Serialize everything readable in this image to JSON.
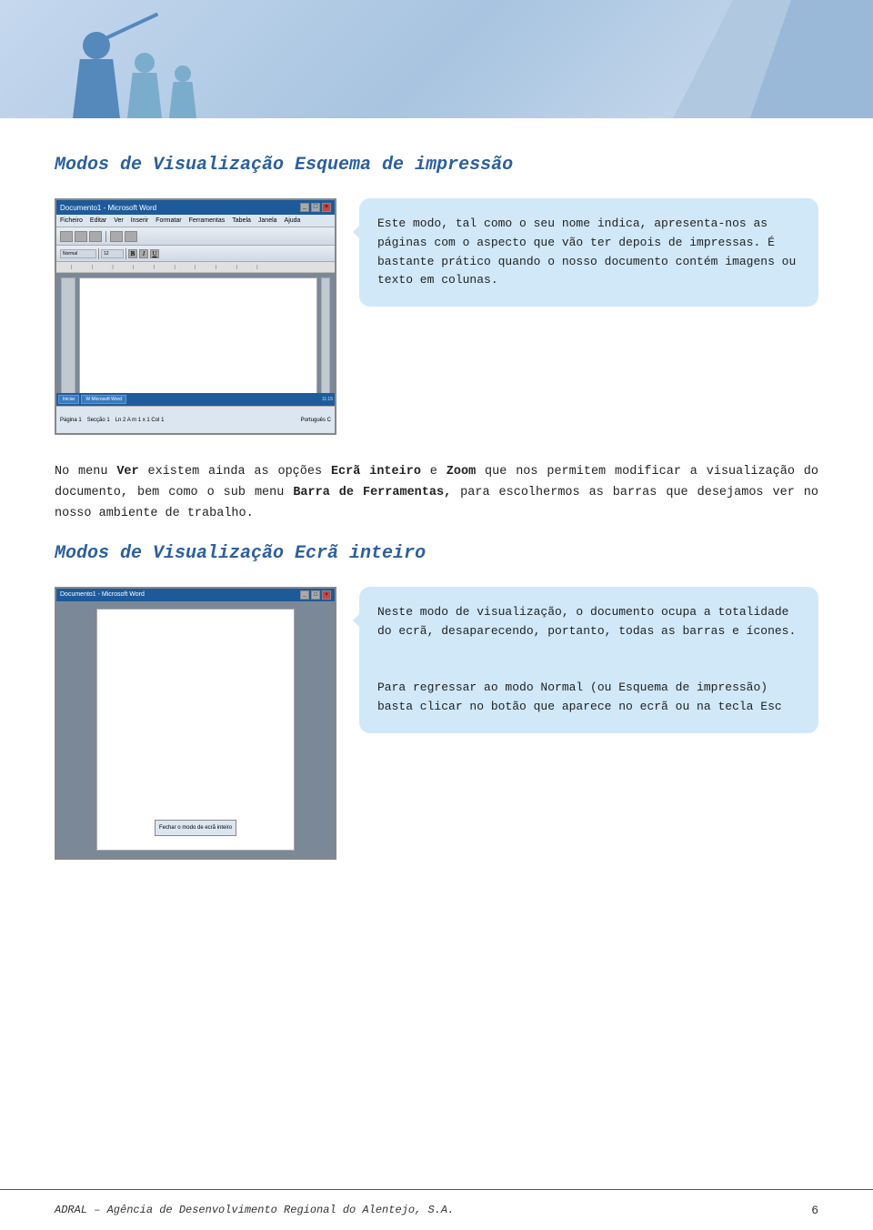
{
  "header": {
    "alt": "Header illustration with figures"
  },
  "section1": {
    "title": "Modos de Visualização Esquema de impressão",
    "callout": {
      "text1": "Este modo, tal como o seu nome indica, apresenta-nos as páginas com o aspecto que vão ter depois de impressas. É bastante prático quando o nosso documento contém imagens ou texto em colunas."
    },
    "screenshot": {
      "titlebar": "Documento1 - Microsoft Word",
      "menubar_items": [
        "Ficheiro",
        "Editar",
        "Ver",
        "Inserir",
        "Formatar",
        "Ferramentas",
        "Tabela",
        "Janela",
        "Ajuda"
      ]
    }
  },
  "body_paragraph": {
    "text": "No menu Ver existem ainda as opções Ecrã inteiro e Zoom que nos permitem modificar a visualização do documento, bem como o sub menu Barra de Ferramentas, para escolhermos as barras que desejamos ver no nosso ambiente de trabalho.",
    "bold_words": [
      "Ver",
      "Ecrã inteiro",
      "Zoom",
      "Barra de",
      "Ferramentas,"
    ]
  },
  "section2": {
    "title": "Modos de Visualização Ecrã inteiro",
    "callout": {
      "text1": "Neste modo de visualização, o documento ocupa a totalidade do ecrã, desaparecendo, portanto, todas as barras e ícones.",
      "text2": "Para regressar ao modo Normal (ou Esquema de impressão) basta clicar no botão que aparece no ecrã ou na tecla Esc"
    },
    "screenshot_btn": "Fechar o modo de ecrã inteiro"
  },
  "footer": {
    "text": "ADRAL – Agência de Desenvolvimento Regional do Alentejo, S.A.",
    "page": "6"
  }
}
